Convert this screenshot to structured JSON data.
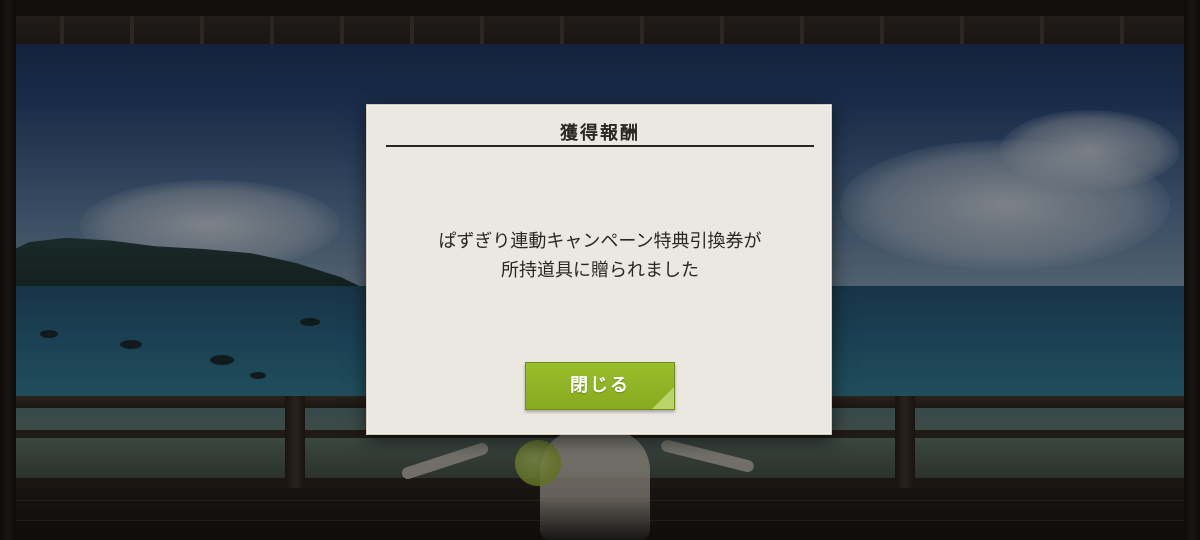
{
  "dialog": {
    "title": "獲得報酬",
    "message_line1": "ぱずぎり連動キャンペーン特典引換券が",
    "message_line2": "所持道具に贈られました",
    "close_label": "閉じる"
  },
  "colors": {
    "dialog_background": "#ebe8e2",
    "button_green": "#8fb526",
    "text_dark": "#2a2622"
  },
  "icons": {
    "button_corner": "corner-fold-icon"
  }
}
